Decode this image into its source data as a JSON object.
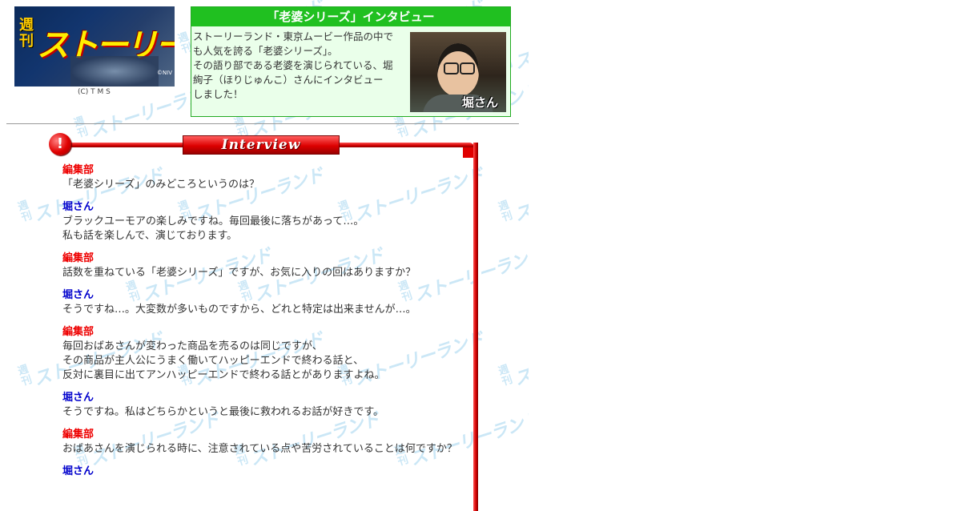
{
  "header": {
    "logo": {
      "badge_text": "週刊",
      "title_text": "ストーリーランド",
      "copyright_mark": "©NIV",
      "credit": "(C) T M S"
    },
    "intro": {
      "title": "「老婆シリーズ」インタビュー",
      "text_lines": [
        "ストーリーランド・東京ムービー作品の中で",
        "も人気を誇る「老婆シリーズ」。",
        "その語り部である老婆を演じられている、堀",
        "絢子（ほりじゅんこ）さんにインタビュー",
        "しました！"
      ],
      "photo_label": "堀さん"
    }
  },
  "section": {
    "bang_glyph": "!",
    "tab_label": "Interview"
  },
  "watermark": {
    "badge_text": "週刊",
    "title_text": "ストーリーランド"
  },
  "dialogue": [
    {
      "speaker": "編集部",
      "role": "editor",
      "lines": [
        "「老婆シリーズ」のみどころというのは？"
      ]
    },
    {
      "speaker": "堀さん",
      "role": "hori",
      "lines": [
        "ブラックユーモアの楽しみですね。毎回最後に落ちがあって…。",
        "私も話を楽しんで、演じております。"
      ]
    },
    {
      "speaker": "編集部",
      "role": "editor",
      "lines": [
        "話数を重ねている「老婆シリーズ」ですが、お気に入りの回はありますか？"
      ]
    },
    {
      "speaker": "堀さん",
      "role": "hori",
      "lines": [
        "そうですね…。大変数が多いものですから、どれと特定は出来ませんが…。"
      ]
    },
    {
      "speaker": "編集部",
      "role": "editor",
      "lines": [
        "毎回おばあさんが変わった商品を売るのは同じですが、",
        "その商品が主人公にうまく働いてハッピーエンドで終わる話と、",
        "反対に裏目に出てアンハッピーエンドで終わる話とがありますよね。"
      ]
    },
    {
      "speaker": "堀さん",
      "role": "hori",
      "lines": [
        "そうですね。私はどちらかというと最後に救われるお話が好きです。"
      ]
    },
    {
      "speaker": "編集部",
      "role": "editor",
      "lines": [
        "おばあさんを演じられる時に、注意されている点や苦労されていることは何ですか？"
      ]
    },
    {
      "speaker": "堀さん",
      "role": "hori",
      "lines": []
    }
  ]
}
